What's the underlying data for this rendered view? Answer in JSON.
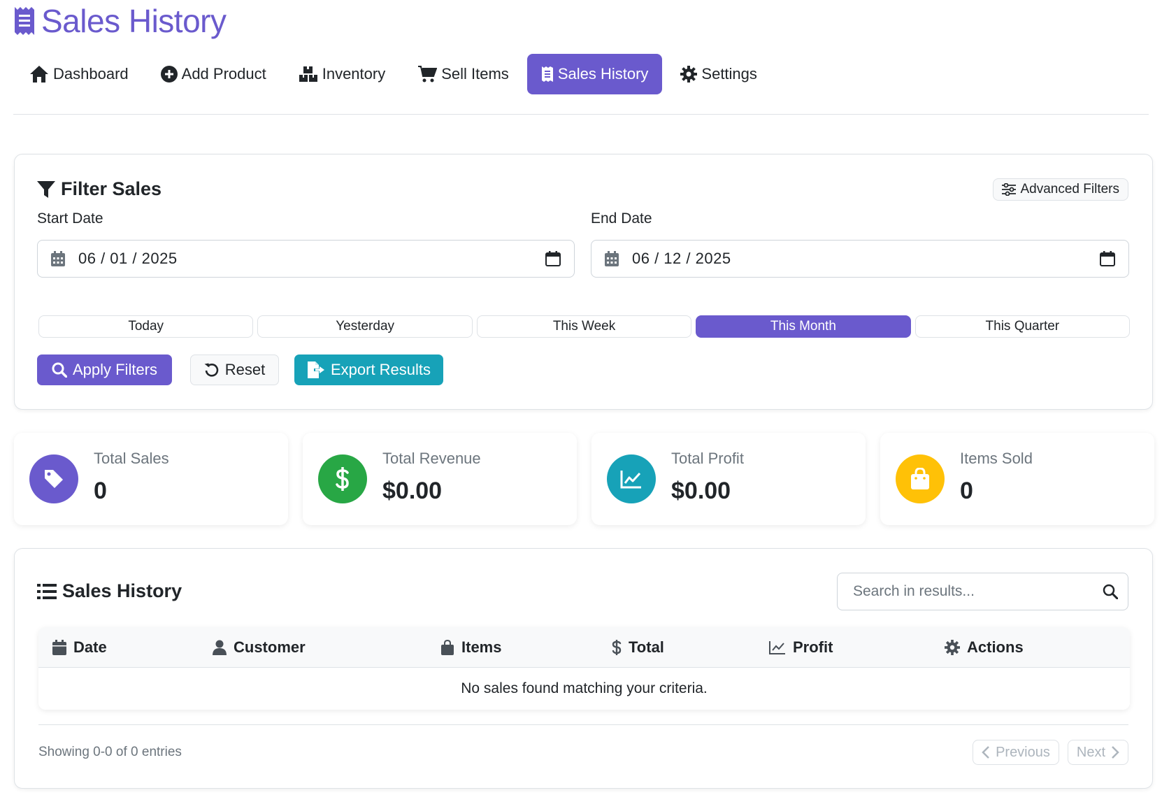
{
  "app": {
    "title": "Sales History",
    "title_icon": "receipt-icon",
    "accent": "#6a5acd"
  },
  "nav": [
    {
      "label": "Dashboard",
      "icon": "home-icon",
      "active": false
    },
    {
      "label": "Add Product",
      "icon": "plus-circle-icon",
      "active": false
    },
    {
      "label": "Inventory",
      "icon": "boxes-icon",
      "active": false
    },
    {
      "label": "Sell Items",
      "icon": "cart-icon",
      "active": false
    },
    {
      "label": "Sales History",
      "icon": "receipt-icon",
      "active": true
    },
    {
      "label": "Settings",
      "icon": "gear-icon",
      "active": false
    }
  ],
  "filter": {
    "title": "Filter Sales",
    "advanced_label": "Advanced Filters",
    "start_label": "Start Date",
    "start_value": "06 / 01 / 2025",
    "end_label": "End Date",
    "end_value": "06 / 12 / 2025",
    "quick": [
      {
        "label": "Today",
        "active": false
      },
      {
        "label": "Yesterday",
        "active": false
      },
      {
        "label": "This Week",
        "active": false
      },
      {
        "label": "This Month",
        "active": true
      },
      {
        "label": "This Quarter",
        "active": false
      }
    ],
    "apply_label": "Apply Filters",
    "reset_label": "Reset",
    "export_label": "Export Results"
  },
  "stats": [
    {
      "label": "Total Sales",
      "value": "0",
      "icon": "tag-icon",
      "color": "#6a5acd"
    },
    {
      "label": "Total Revenue",
      "value": "$0.00",
      "icon": "dollar-icon",
      "color": "#28a745"
    },
    {
      "label": "Total Profit",
      "value": "$0.00",
      "icon": "chart-line-icon",
      "color": "#17a2b8"
    },
    {
      "label": "Items Sold",
      "value": "0",
      "icon": "shopping-bag-icon",
      "color": "#ffc107"
    }
  ],
  "history": {
    "title": "Sales History",
    "search_placeholder": "Search in results...",
    "columns": [
      {
        "label": "Date",
        "icon": "calendar-icon"
      },
      {
        "label": "Customer",
        "icon": "user-icon"
      },
      {
        "label": "Items",
        "icon": "bag-icon"
      },
      {
        "label": "Total",
        "icon": "dollar-icon"
      },
      {
        "label": "Profit",
        "icon": "chart-line-icon"
      },
      {
        "label": "Actions",
        "icon": "gear-icon"
      }
    ],
    "empty_message": "No sales found matching your criteria.",
    "showing": "Showing 0-0 of 0 entries",
    "prev_label": "Previous",
    "next_label": "Next"
  }
}
